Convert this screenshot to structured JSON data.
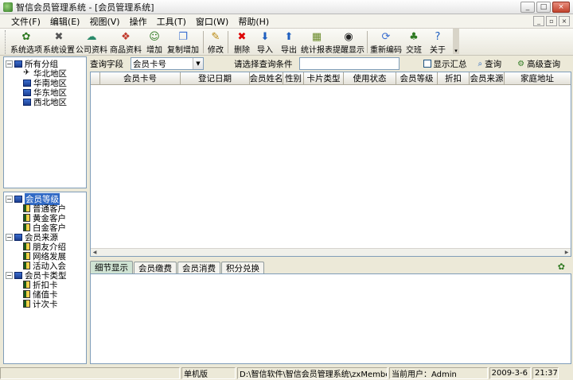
{
  "window": {
    "title": "智信会员管理系统 - [会员管理系统]",
    "buttons": [
      "_",
      "□",
      "×"
    ]
  },
  "menu": [
    "文件(F)",
    "编辑(E)",
    "视图(V)",
    "操作",
    "工具(T)",
    "窗口(W)",
    "帮助(H)"
  ],
  "toolbar": [
    {
      "label": "系统选项",
      "icon": "system-options-icon"
    },
    {
      "label": "系统设置",
      "icon": "tools-icon"
    },
    {
      "label": "公司资料",
      "icon": "company-icon"
    },
    {
      "label": "商品资料",
      "icon": "goods-icon"
    },
    {
      "label": "增加",
      "icon": "add-user-icon"
    },
    {
      "label": "复制增加",
      "icon": "copy-add-icon"
    },
    {
      "label": "修改",
      "icon": "edit-icon"
    },
    {
      "label": "删除",
      "icon": "delete-icon"
    },
    {
      "label": "导入",
      "icon": "import-icon"
    },
    {
      "label": "导出",
      "icon": "export-icon"
    },
    {
      "label": "统计报表",
      "icon": "report-icon"
    },
    {
      "label": "提醒显示",
      "icon": "reminder-icon"
    },
    {
      "label": "重新编码",
      "icon": "recode-icon"
    },
    {
      "label": "交班",
      "icon": "handover-icon"
    },
    {
      "label": "关于",
      "icon": "help-icon"
    }
  ],
  "tree_top": {
    "root": "所有分组",
    "children": [
      "华北地区",
      "华南地区",
      "华东地区",
      "西北地区"
    ]
  },
  "tree_bottom": [
    {
      "label": "会员等级",
      "children": [
        "普通客户",
        "黄金客户",
        "白金客户"
      ]
    },
    {
      "label": "会员来源",
      "children": [
        "朋友介绍",
        "网络发展",
        "活动入会"
      ]
    },
    {
      "label": "会员卡类型",
      "children": [
        "折扣卡",
        "储值卡",
        "计次卡"
      ]
    }
  ],
  "query": {
    "field_label": "查询字段",
    "field_value": "会员卡号",
    "condition_hint": "请选择查询条件",
    "input_value": "",
    "show_summary": "显示汇总",
    "search_btn": "查询",
    "advanced_btn": "高级查询"
  },
  "grid_columns": [
    "会员卡号",
    "登记日期",
    "会员姓名",
    "性别",
    "卡片类型",
    "使用状态",
    "会员等级",
    "折扣",
    "会员来源",
    "家庭地址"
  ],
  "tabs": [
    "细节显示",
    "会员缴费",
    "会员消费",
    "积分兑换"
  ],
  "status": {
    "mode": "单机版",
    "path": "D:\\智信软件\\智信会员管理系统\\zxMemberData.sys",
    "user": "当前用户：Admin",
    "date": "2009-3-6",
    "time": "21:37"
  },
  "colors": {
    "selection": "#316AC5",
    "active_tab": "#CFE3D3"
  }
}
